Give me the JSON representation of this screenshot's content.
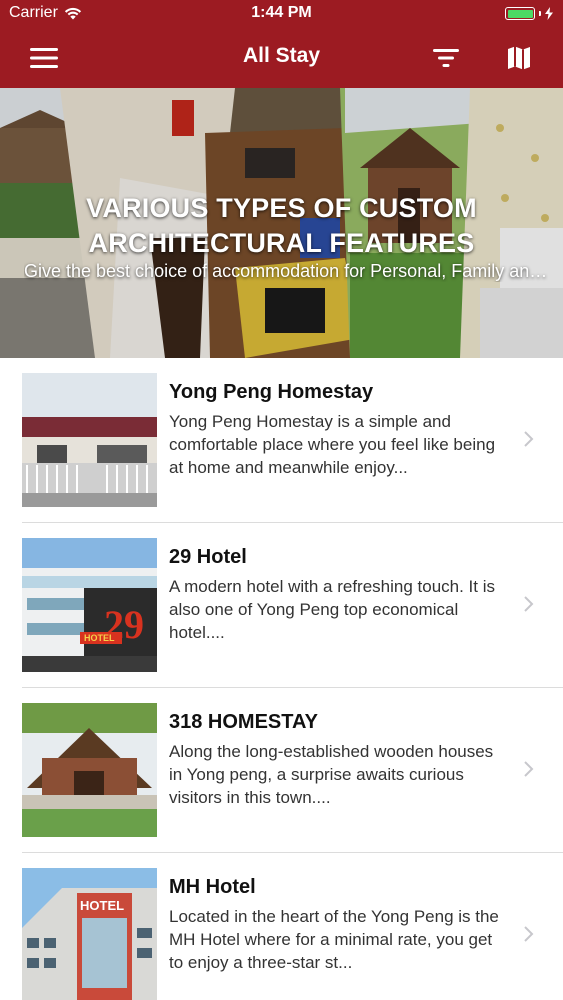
{
  "status_bar": {
    "carrier": "Carrier",
    "time": "1:44 PM",
    "battery_color": "#4cd964",
    "wifi_icon": "wifi-icon",
    "charging_icon": "bolt-icon"
  },
  "nav": {
    "title": "All Stay",
    "background": "#9c1b22",
    "left_icon": "hamburger-menu-icon",
    "right_icons": [
      "filter-icon",
      "map-icon"
    ]
  },
  "banner": {
    "title": "VARIOUS TYPES OF CUSTOM ARCHITECTURAL FEATURES",
    "subtitle": "Give the best choice of accommodation for Personal, Family and Group trip"
  },
  "listings": [
    {
      "name": "Yong Peng Homestay",
      "description": "Yong Peng Homestay is a simple and comfortable place where you feel like being at home and meanwhile enjoy..."
    },
    {
      "name": "29 Hotel",
      "description": "A modern hotel with a refreshing touch. It is also one of Yong Peng top economical hotel...."
    },
    {
      "name": "318 HOMESTAY",
      "description": "Along the long-established wooden houses in Yong peng, a surprise awaits curious visitors in this town...."
    },
    {
      "name": "MH Hotel",
      "description": "Located in the heart of the Yong Peng is the MH Hotel where for a minimal rate, you get to enjoy a three-star st..."
    }
  ],
  "thumb_signs": {
    "hotel_29_sign": "29",
    "hotel_29_caption": "HOTEL",
    "mh_hotel_sign": "HOTEL"
  }
}
